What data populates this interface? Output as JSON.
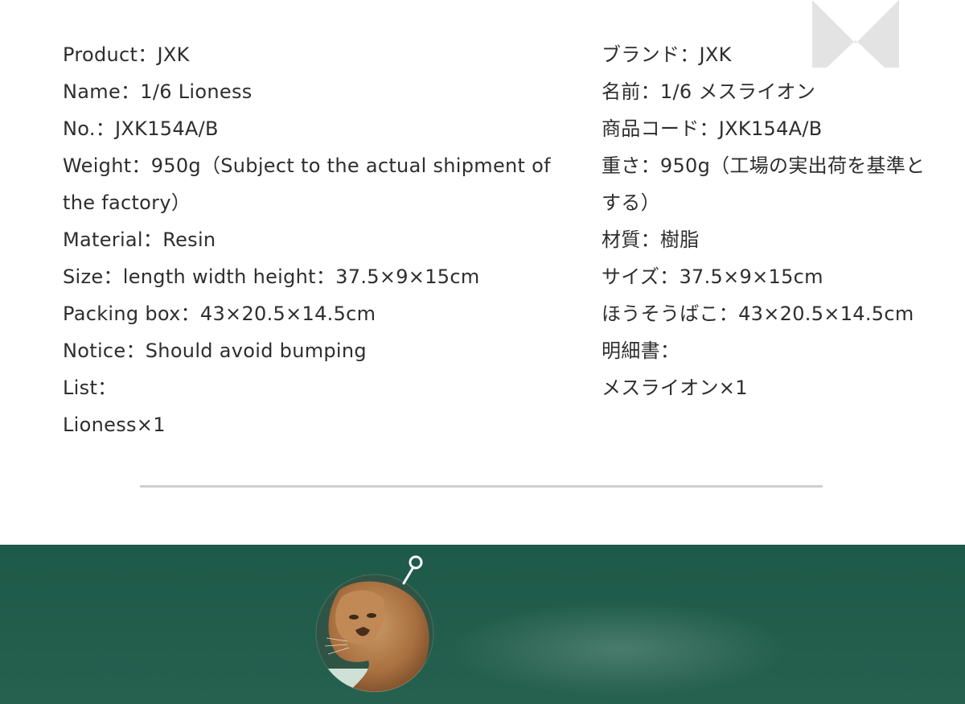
{
  "spec_en": [
    "Product：JXK",
    "Name：1/6 Lioness",
    "No.：JXK154A/B",
    "Weight：950g（Subject to the actual shipment of",
    "the factory）",
    "Material：Resin",
    "Size：length width height：37.5×9×15cm",
    "Packing box：43×20.5×14.5cm",
    "Notice：Should avoid bumping",
    "List：",
    "Lioness×1"
  ],
  "spec_ja": [
    "ブランド：JXK",
    "名前：1/6 メスライオン",
    "商品コード：JXK154A/B",
    "重さ：950g（工場の実出荷を基準と",
    "する）",
    "材質：樹脂",
    "サイズ：37.5×9×15cm",
    "ほうそうばこ：43×20.5×14.5cm",
    "明細書：",
    "メスライオン×1"
  ],
  "colors": {
    "text": "#2e2e2e",
    "divider": "#cfcfcf",
    "band_green": "#1e5a49",
    "chevron": "#e3e3e3"
  },
  "icons": {
    "top_decoration": "chevron-up-icon",
    "photo_marker": "zoom-pin-icon"
  }
}
